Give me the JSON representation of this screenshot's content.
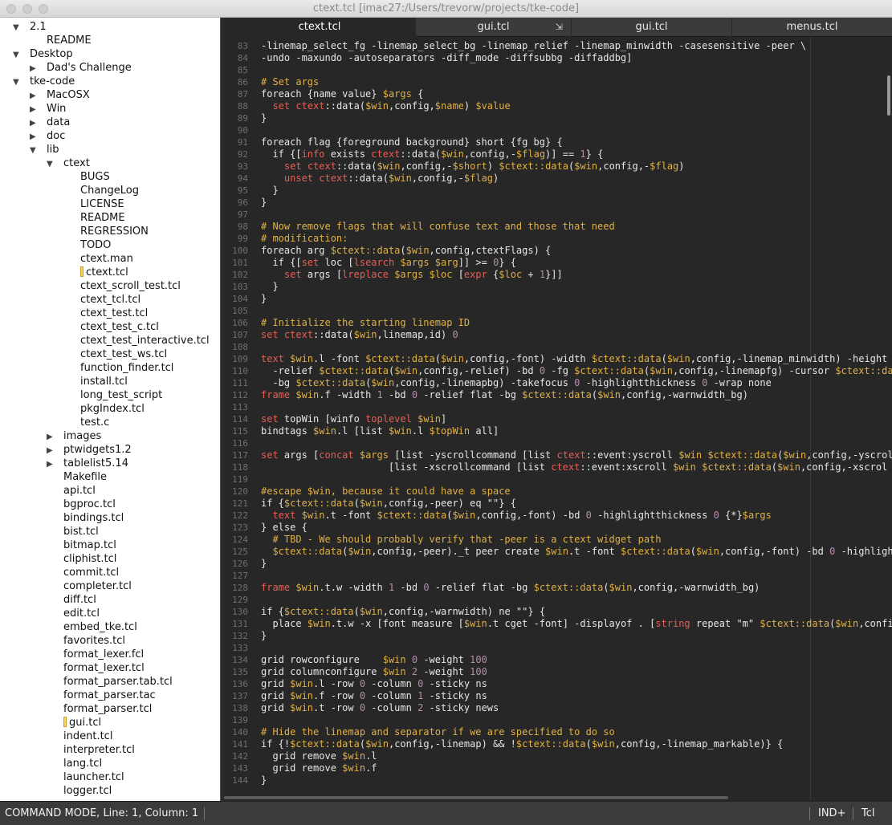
{
  "window": {
    "title": "ctext.tcl [imac27:/Users/trevorw/projects/tke-code]"
  },
  "sidebar": {
    "items": [
      {
        "label": "2.1",
        "depth": 0,
        "arrow": "expanded"
      },
      {
        "label": "README",
        "depth": 1,
        "arrow": "none"
      },
      {
        "label": "Desktop",
        "depth": 0,
        "arrow": "expanded"
      },
      {
        "label": "Dad's Challenge",
        "depth": 1,
        "arrow": "collapsed"
      },
      {
        "label": "tke-code",
        "depth": 0,
        "arrow": "expanded"
      },
      {
        "label": "MacOSX",
        "depth": 1,
        "arrow": "collapsed"
      },
      {
        "label": "Win",
        "depth": 1,
        "arrow": "collapsed"
      },
      {
        "label": "data",
        "depth": 1,
        "arrow": "collapsed"
      },
      {
        "label": "doc",
        "depth": 1,
        "arrow": "collapsed"
      },
      {
        "label": "lib",
        "depth": 1,
        "arrow": "expanded"
      },
      {
        "label": "ctext",
        "depth": 2,
        "arrow": "expanded"
      },
      {
        "label": "BUGS",
        "depth": 3,
        "arrow": "none"
      },
      {
        "label": "ChangeLog",
        "depth": 3,
        "arrow": "none"
      },
      {
        "label": "LICENSE",
        "depth": 3,
        "arrow": "none"
      },
      {
        "label": "README",
        "depth": 3,
        "arrow": "none"
      },
      {
        "label": "REGRESSION",
        "depth": 3,
        "arrow": "none"
      },
      {
        "label": "TODO",
        "depth": 3,
        "arrow": "none"
      },
      {
        "label": "ctext.man",
        "depth": 3,
        "arrow": "none"
      },
      {
        "label": "ctext.tcl",
        "depth": 3,
        "arrow": "none",
        "marked": true
      },
      {
        "label": "ctext_scroll_test.tcl",
        "depth": 3,
        "arrow": "none"
      },
      {
        "label": "ctext_tcl.tcl",
        "depth": 3,
        "arrow": "none"
      },
      {
        "label": "ctext_test.tcl",
        "depth": 3,
        "arrow": "none"
      },
      {
        "label": "ctext_test_c.tcl",
        "depth": 3,
        "arrow": "none"
      },
      {
        "label": "ctext_test_interactive.tcl",
        "depth": 3,
        "arrow": "none"
      },
      {
        "label": "ctext_test_ws.tcl",
        "depth": 3,
        "arrow": "none"
      },
      {
        "label": "function_finder.tcl",
        "depth": 3,
        "arrow": "none"
      },
      {
        "label": "install.tcl",
        "depth": 3,
        "arrow": "none"
      },
      {
        "label": "long_test_script",
        "depth": 3,
        "arrow": "none"
      },
      {
        "label": "pkgIndex.tcl",
        "depth": 3,
        "arrow": "none"
      },
      {
        "label": "test.c",
        "depth": 3,
        "arrow": "none"
      },
      {
        "label": "images",
        "depth": 2,
        "arrow": "collapsed"
      },
      {
        "label": "ptwidgets1.2",
        "depth": 2,
        "arrow": "collapsed"
      },
      {
        "label": "tablelist5.14",
        "depth": 2,
        "arrow": "collapsed"
      },
      {
        "label": "Makefile",
        "depth": 2,
        "arrow": "none"
      },
      {
        "label": "api.tcl",
        "depth": 2,
        "arrow": "none"
      },
      {
        "label": "bgproc.tcl",
        "depth": 2,
        "arrow": "none"
      },
      {
        "label": "bindings.tcl",
        "depth": 2,
        "arrow": "none"
      },
      {
        "label": "bist.tcl",
        "depth": 2,
        "arrow": "none"
      },
      {
        "label": "bitmap.tcl",
        "depth": 2,
        "arrow": "none"
      },
      {
        "label": "cliphist.tcl",
        "depth": 2,
        "arrow": "none"
      },
      {
        "label": "commit.tcl",
        "depth": 2,
        "arrow": "none"
      },
      {
        "label": "completer.tcl",
        "depth": 2,
        "arrow": "none"
      },
      {
        "label": "diff.tcl",
        "depth": 2,
        "arrow": "none"
      },
      {
        "label": "edit.tcl",
        "depth": 2,
        "arrow": "none"
      },
      {
        "label": "embed_tke.tcl",
        "depth": 2,
        "arrow": "none"
      },
      {
        "label": "favorites.tcl",
        "depth": 2,
        "arrow": "none"
      },
      {
        "label": "format_lexer.fcl",
        "depth": 2,
        "arrow": "none"
      },
      {
        "label": "format_lexer.tcl",
        "depth": 2,
        "arrow": "none"
      },
      {
        "label": "format_parser.tab.tcl",
        "depth": 2,
        "arrow": "none"
      },
      {
        "label": "format_parser.tac",
        "depth": 2,
        "arrow": "none"
      },
      {
        "label": "format_parser.tcl",
        "depth": 2,
        "arrow": "none"
      },
      {
        "label": "gui.tcl",
        "depth": 2,
        "arrow": "none",
        "marked": true
      },
      {
        "label": "indent.tcl",
        "depth": 2,
        "arrow": "none"
      },
      {
        "label": "interpreter.tcl",
        "depth": 2,
        "arrow": "none"
      },
      {
        "label": "lang.tcl",
        "depth": 2,
        "arrow": "none"
      },
      {
        "label": "launcher.tcl",
        "depth": 2,
        "arrow": "none"
      },
      {
        "label": "logger.tcl",
        "depth": 2,
        "arrow": "none"
      }
    ]
  },
  "tabs": [
    {
      "label": "ctext.tcl",
      "active": true
    },
    {
      "label": "gui.tcl",
      "active": false,
      "close_icon": "⇲"
    },
    {
      "label": "gui.tcl",
      "active": false
    },
    {
      "label": "menus.tcl",
      "active": false
    }
  ],
  "editor": {
    "lines": [
      {
        "n": "83",
        "t": "-linemap_select_fg -linemap_select_bg -linemap_relief -linemap_minwidth -casesensitive -peer \\"
      },
      {
        "n": "84",
        "t": "-undo -maxundo -autoseparators -diff_mode -diffsubbg -diffaddbg]"
      },
      {
        "n": "85",
        "t": ""
      },
      {
        "n": "86",
        "t": "# Set args",
        "k": "comment"
      },
      {
        "n": "87",
        "t": "foreach {name value} $args {"
      },
      {
        "n": "88",
        "t": "  set ctext::data($win,config,$name) $value"
      },
      {
        "n": "89",
        "t": "}"
      },
      {
        "n": "90",
        "t": ""
      },
      {
        "n": "91",
        "t": "foreach flag {foreground background} short {fg bg} {"
      },
      {
        "n": "92",
        "t": "  if {[info exists ctext::data($win,config,-$flag)] == 1} {"
      },
      {
        "n": "93",
        "t": "    set ctext::data($win,config,-$short) $ctext::data($win,config,-$flag)"
      },
      {
        "n": "94",
        "t": "    unset ctext::data($win,config,-$flag)"
      },
      {
        "n": "95",
        "t": "  }"
      },
      {
        "n": "96",
        "t": "}"
      },
      {
        "n": "97",
        "t": ""
      },
      {
        "n": "98",
        "t": "# Now remove flags that will confuse text and those that need",
        "k": "comment"
      },
      {
        "n": "99",
        "t": "# modification:",
        "k": "comment"
      },
      {
        "n": "100",
        "t": "foreach arg $ctext::data($win,config,ctextFlags) {"
      },
      {
        "n": "101",
        "t": "  if {[set loc [lsearch $args $arg]] >= 0} {"
      },
      {
        "n": "102",
        "t": "    set args [lreplace $args $loc [expr {$loc + 1}]]"
      },
      {
        "n": "103",
        "t": "  }"
      },
      {
        "n": "104",
        "t": "}"
      },
      {
        "n": "105",
        "t": ""
      },
      {
        "n": "106",
        "t": "# Initialize the starting linemap ID",
        "k": "comment"
      },
      {
        "n": "107",
        "t": "set ctext::data($win,linemap,id) 0"
      },
      {
        "n": "108",
        "t": ""
      },
      {
        "n": "109",
        "t": "text $win.l -font $ctext::data($win,config,-font) -width $ctext::data($win,config,-linemap_minwidth) -height 1"
      },
      {
        "n": "110",
        "t": "  -relief $ctext::data($win,config,-relief) -bd 0 -fg $ctext::data($win,config,-linemapfg) -cursor $ctext::dat"
      },
      {
        "n": "111",
        "t": "  -bg $ctext::data($win,config,-linemapbg) -takefocus 0 -highlightthickness 0 -wrap none"
      },
      {
        "n": "112",
        "t": "frame $win.f -width 1 -bd 0 -relief flat -bg $ctext::data($win,config,-warnwidth_bg)"
      },
      {
        "n": "113",
        "t": ""
      },
      {
        "n": "114",
        "t": "set topWin [winfo toplevel $win]"
      },
      {
        "n": "115",
        "t": "bindtags $win.l [list $win.l $topWin all]"
      },
      {
        "n": "116",
        "t": ""
      },
      {
        "n": "117",
        "t": "set args [concat $args [list -yscrollcommand [list ctext::event:yscroll $win $ctext::data($win,config,-yscrol"
      },
      {
        "n": "118",
        "t": "                      [list -xscrollcommand [list ctext::event:xscroll $win $ctext::data($win,config,-xscrol"
      },
      {
        "n": "119",
        "t": ""
      },
      {
        "n": "120",
        "t": "#escape $win, because it could have a space",
        "k": "comment"
      },
      {
        "n": "121",
        "t": "if {$ctext::data($win,config,-peer) eq \"\"} {"
      },
      {
        "n": "122",
        "t": "  text $win.t -font $ctext::data($win,config,-font) -bd 0 -highlightthickness 0 {*}$args"
      },
      {
        "n": "123",
        "t": "} else {"
      },
      {
        "n": "124",
        "t": "  # TBD - We should probably verify that -peer is a ctext widget path",
        "k": "comment"
      },
      {
        "n": "125",
        "t": "  $ctext::data($win,config,-peer)._t peer create $win.t -font $ctext::data($win,config,-font) -bd 0 -highligh"
      },
      {
        "n": "126",
        "t": "}"
      },
      {
        "n": "127",
        "t": ""
      },
      {
        "n": "128",
        "t": "frame $win.t.w -width 1 -bd 0 -relief flat -bg $ctext::data($win,config,-warnwidth_bg)"
      },
      {
        "n": "129",
        "t": ""
      },
      {
        "n": "130",
        "t": "if {$ctext::data($win,config,-warnwidth) ne \"\"} {"
      },
      {
        "n": "131",
        "t": "  place $win.t.w -x [font measure [$win.t cget -font] -displayof . [string repeat \"m\" $ctext::data($win,confi"
      },
      {
        "n": "132",
        "t": "}"
      },
      {
        "n": "133",
        "t": ""
      },
      {
        "n": "134",
        "t": "grid rowconfigure    $win 0 -weight 100"
      },
      {
        "n": "135",
        "t": "grid columnconfigure $win 2 -weight 100"
      },
      {
        "n": "136",
        "t": "grid $win.l -row 0 -column 0 -sticky ns"
      },
      {
        "n": "137",
        "t": "grid $win.f -row 0 -column 1 -sticky ns"
      },
      {
        "n": "138",
        "t": "grid $win.t -row 0 -column 2 -sticky news"
      },
      {
        "n": "139",
        "t": ""
      },
      {
        "n": "140",
        "t": "# Hide the linemap and separator if we are specified to do so",
        "k": "comment"
      },
      {
        "n": "141",
        "t": "if {!$ctext::data($win,config,-linemap) && !$ctext::data($win,config,-linemap_markable)} {"
      },
      {
        "n": "142",
        "t": "  grid remove $win.l"
      },
      {
        "n": "143",
        "t": "  grid remove $win.f"
      },
      {
        "n": "144",
        "t": "}"
      }
    ]
  },
  "statusbar": {
    "mode": "COMMAND MODE, Line: 1, Column: 1",
    "indent": "IND+",
    "language": "Tcl"
  },
  "colors": {
    "comment": "#e0b045",
    "editor_bg": "#272727",
    "sidebar_bg": "#ffffff"
  }
}
